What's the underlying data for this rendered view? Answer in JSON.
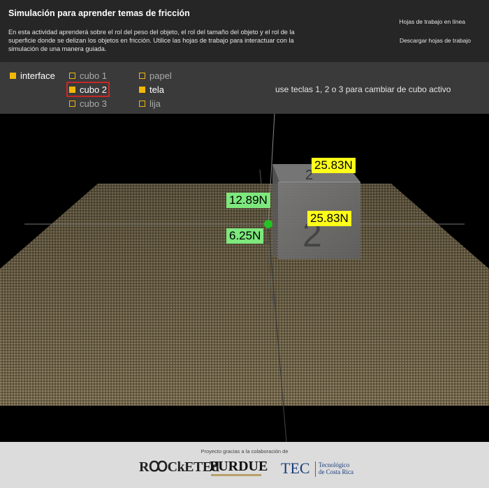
{
  "header": {
    "title": "Simulación para aprender temas de fricción",
    "description": "En esta actividad aprenderá sobre el rol del peso del objeto, el rol del tamaño del objeto y el rol de la superficie donde se delizan los objetos en fricción. Utilice las hojas de trabajo para interactuar con la simulación de una manera guiada.",
    "link_worksheets_online": "Hojas de trabajo en línea",
    "link_download_worksheets": "Descargar hojas de trabajo"
  },
  "controls": {
    "interface": {
      "label": "interface",
      "checked": true
    },
    "cubes": [
      {
        "label": "cubo 1",
        "checked": false
      },
      {
        "label": "cubo 2",
        "checked": true
      },
      {
        "label": "cubo 3",
        "checked": false
      }
    ],
    "surfaces": [
      {
        "label": "papel",
        "checked": false
      },
      {
        "label": "tela",
        "checked": true
      },
      {
        "label": "lija",
        "checked": false
      }
    ],
    "hint": "use teclas 1, 2 o 3 para cambiar de cubo activo"
  },
  "scene": {
    "cube_number": "2",
    "forces": {
      "top": "25.83N",
      "side": "25.83N",
      "upper_left": "12.89N",
      "lower_left": "6.25N"
    },
    "colors": {
      "weight_label": "#ffff1a",
      "friction_label": "#7de87d",
      "origin_marker": "#22c422"
    }
  },
  "footer": {
    "credit": "Proyecto gracias a la colaboración de",
    "logos": {
      "rocketed": "RꝎCkETEd",
      "purdue": "PURDUE",
      "tec": "TEC",
      "tec_subtitle_1": "Tecnológico",
      "tec_subtitle_2": "de Costa Rica"
    }
  }
}
